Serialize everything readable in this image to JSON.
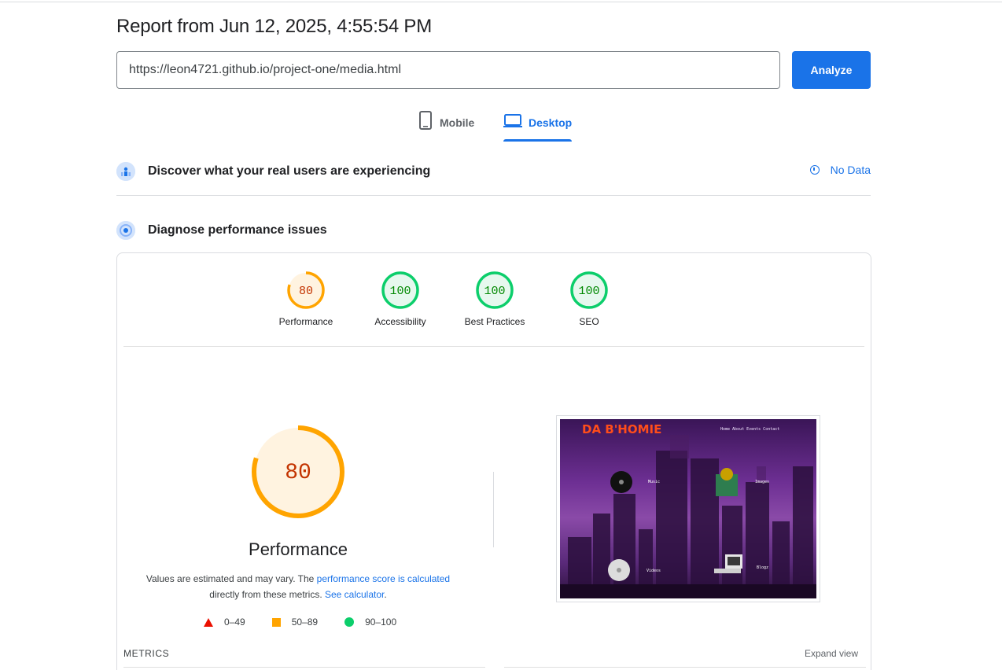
{
  "header": {
    "title": "Report from Jun 12, 2025, 4:55:54 PM",
    "url_value": "https://leon4721.github.io/project-one/media.html",
    "analyze_label": "Analyze"
  },
  "tabs": [
    {
      "label": "Mobile",
      "icon": "smartphone-icon",
      "active": false
    },
    {
      "label": "Desktop",
      "icon": "laptop-icon",
      "active": true
    }
  ],
  "sections": {
    "discover_title": "Discover what your real users are experiencing",
    "no_data_label": "No Data",
    "diagnose_title": "Diagnose performance issues"
  },
  "scores": [
    {
      "label": "Performance",
      "value": "80",
      "color": "#ffa400",
      "bg": "#fff3e0",
      "text_color": "#c33300"
    },
    {
      "label": "Accessibility",
      "value": "100",
      "color": "#0cce6b",
      "bg": "#e6f8ee",
      "text_color": "#008800"
    },
    {
      "label": "Best Practices",
      "value": "100",
      "color": "#0cce6b",
      "bg": "#e6f8ee",
      "text_color": "#008800"
    },
    {
      "label": "SEO",
      "value": "100",
      "color": "#0cce6b",
      "bg": "#e6f8ee",
      "text_color": "#008800"
    }
  ],
  "performance": {
    "score": "80",
    "fraction": 0.8,
    "title": "Performance",
    "desc_prefix": "Values are estimated and may vary. The ",
    "desc_link1": "performance score is calculated",
    "desc_middle": "directly from these metrics. ",
    "desc_link2": "See calculator",
    "desc_suffix": "."
  },
  "legend": [
    {
      "shape": "triangle",
      "label": "0–49",
      "color": "#eb0f00"
    },
    {
      "shape": "square",
      "label": "50–89",
      "color": "#ffa400"
    },
    {
      "shape": "circle",
      "label": "90–100",
      "color": "#0cce6b"
    }
  ],
  "screenshot": {
    "site_title": "DA B'HOMIE",
    "nav": "Home About Events Contact",
    "labels": [
      "Music",
      "Images",
      "Videos",
      "Blogz"
    ]
  },
  "metrics": {
    "label": "METRICS",
    "expand_label": "Expand view"
  }
}
